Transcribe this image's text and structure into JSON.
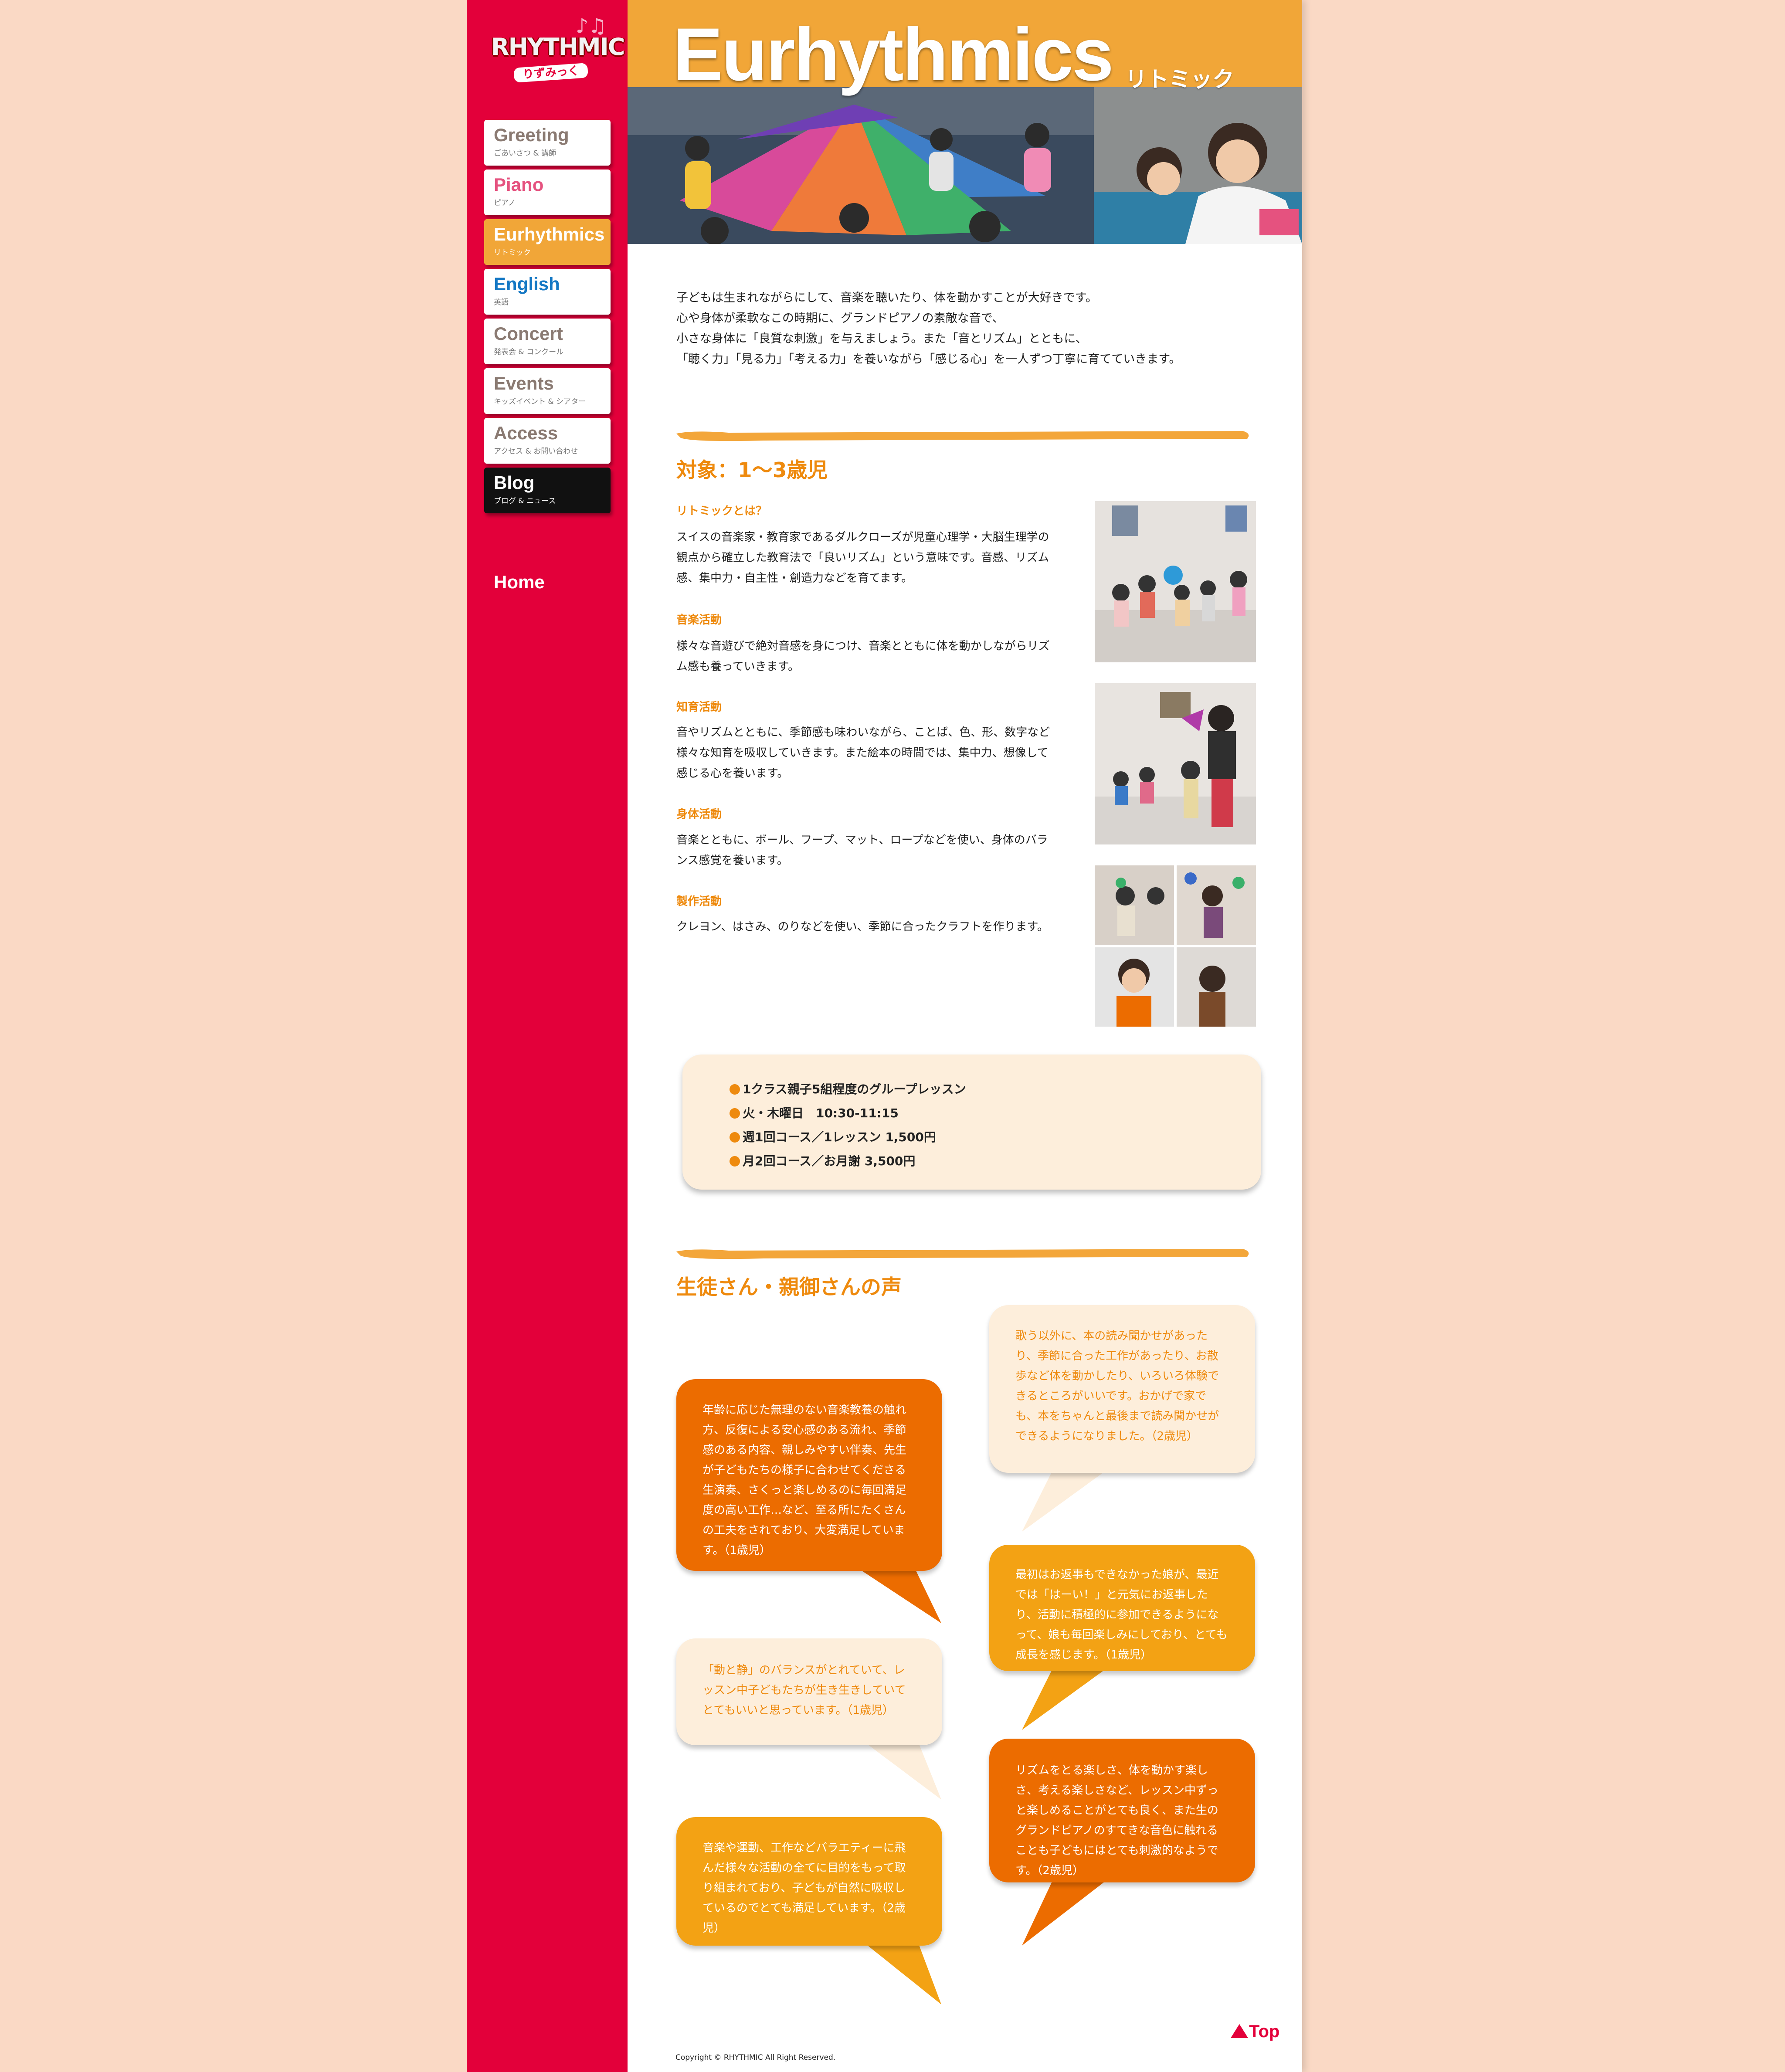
{
  "logo": {
    "word": "RHYTHMIC",
    "sub": "りずみっく"
  },
  "nav": [
    {
      "title": "Greeting",
      "sub": "ごあいさつ & 講師",
      "color": "#8a7a72"
    },
    {
      "title": "Piano",
      "sub": "ピアノ",
      "color": "#e5527f"
    },
    {
      "title": "Eurhythmics",
      "sub": "リトミック",
      "color": "#ffffff",
      "active": true
    },
    {
      "title": "English",
      "sub": "英語",
      "color": "#1578c4"
    },
    {
      "title": "Concert",
      "sub": "発表会 & コンクール",
      "color": "#8a7a72"
    },
    {
      "title": "Events",
      "sub": "キッズイベント & シアター",
      "color": "#8a7a72"
    },
    {
      "title": "Access",
      "sub": "アクセス & お問い合わせ",
      "color": "#8a7a72"
    },
    {
      "title": "Blog",
      "sub": "ブログ & ニュース",
      "color": "#ffffff"
    }
  ],
  "home": "Home",
  "header": {
    "title": "Eurhythmics",
    "sub": "リトミック"
  },
  "intro": [
    "子どもは生まれながらにして、音楽を聴いたり、体を動かすことが大好きです。",
    "心や身体が柔軟なこの時期に、グランドピアノの素敵な音で、",
    "小さな身体に「良質な刺激」を与えましょう。また「音とリズム」とともに、",
    "「聴く力」「見る力」「考える力」を養いながら「感じる心」を一人ずつ丁寧に育てていきます。"
  ],
  "section1": {
    "heading": "対象：1〜3歳児",
    "items": [
      {
        "title": "リトミックとは？",
        "text": "スイスの音楽家・教育家であるダルクローズが児童心理学・大脳生理学の観点から確立した教育法で「良いリズム」という意味です。音感、リズム感、集中力・自主性・創造力などを育てます。"
      },
      {
        "title": "音楽活動",
        "text": "様々な音遊びで絶対音感を身につけ、音楽とともに体を動かしながらリズム感も養っていきます。"
      },
      {
        "title": "知育活動",
        "text": "音やリズムとともに、季節感も味わいながら、ことば、色、形、数字など様々な知育を吸収していきます。また絵本の時間では、集中力、想像して感じる心を養います。"
      },
      {
        "title": "身体活動",
        "text": "音楽とともに、ボール、フープ、マット、ロープなどを使い、身体のバランス感覚を養います。"
      },
      {
        "title": "製作活動",
        "text": "クレヨン、はさみ、のりなどを使い、季節に合ったクラフトを作ります。"
      }
    ]
  },
  "info": [
    "1クラス親子5組程度のグループレッスン",
    "火・木曜日　10:30-11:15",
    "週1回コース／1レッスン 1,500円",
    "月2回コース／お月謝 3,500円"
  ],
  "section2": {
    "heading": "生徒さん・親御さんの声",
    "voices": [
      "年齢に応じた無理のない音楽教養の触れ方、反復による安心感のある流れ、季節感のある内容、親しみやすい伴奏、先生が子どもたちの様子に合わせてくださる生演奏、さくっと楽しめるのに毎回満足度の高い工作…など、至る所にたくさんの工夫をされており、大変満足しています。（1歳児）",
      "歌う以外に、本の読み聞かせがあったり、季節に合った工作があったり、お散歩など体を動かしたり、いろいろ体験できるところがいいです。おかげで家でも、本をちゃんと最後まで読み聞かせができるようになりました。（2歳児）",
      "最初はお返事もできなかった娘が、最近では「はーい！」と元気にお返事したり、活動に積極的に参加できるようになって、娘も毎回楽しみにしており、とても成長を感じます。（1歳児）",
      "「動と静」のバランスがとれていて、レッスン中子どもたちが生き生きしていてとてもいいと思っています。（1歳児）",
      "リズムをとる楽しさ、体を動かす楽しさ、考える楽しさなど、レッスン中ずっと楽しめることがとても良く、また生のグランドピアノのすてきな音色に触れることも子どもにはとても刺激的なようです。（2歳児）",
      "音楽や運動、工作などバラエティーに飛んだ様々な活動の全てに目的をもって取り組まれており、子どもが自然に吸収しているのでとても満足しています。（2歳児）"
    ]
  },
  "top": "Top",
  "copyright": "Copyright © RHYTHMIC All Right Reserved."
}
